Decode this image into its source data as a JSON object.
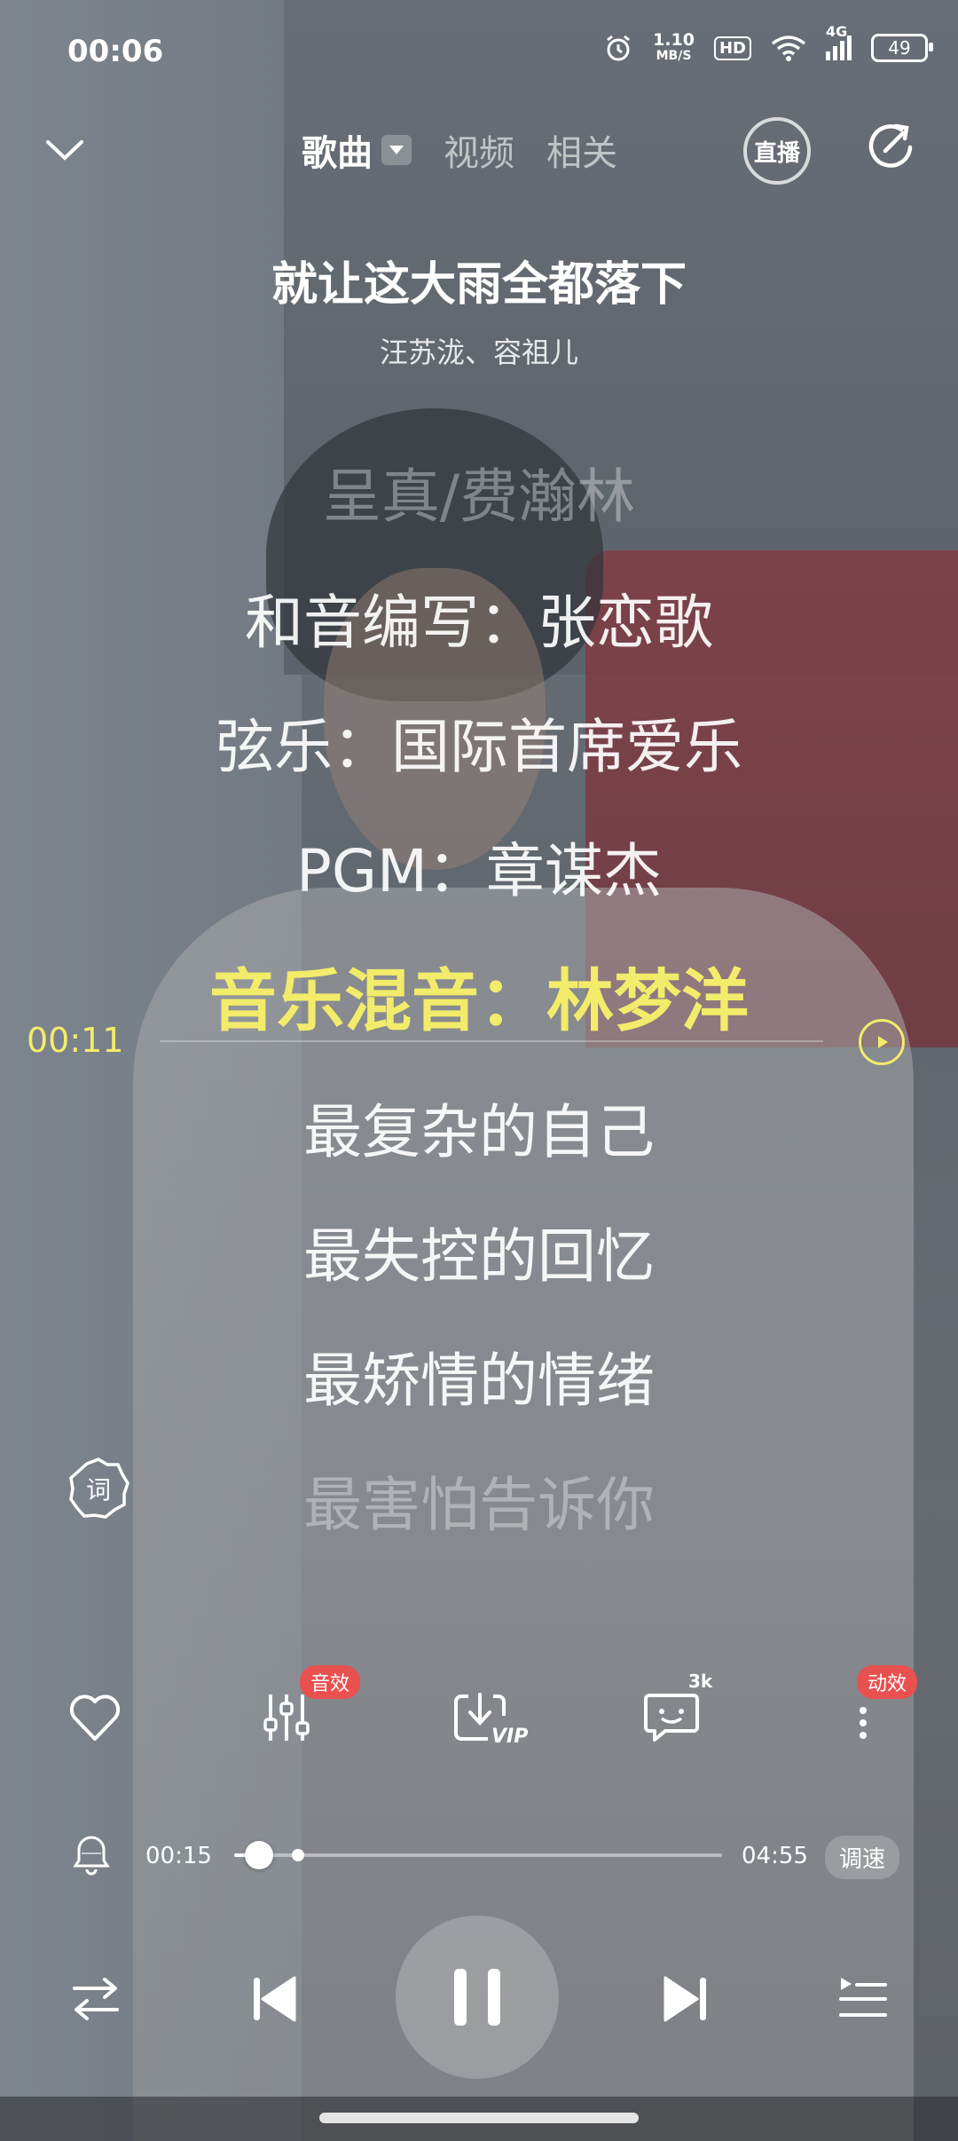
{
  "status_bar": {
    "time": "00:06",
    "net_speed_value": "1.10",
    "net_speed_unit": "MB/S",
    "hd_label": "HD",
    "signal_label": "4G",
    "battery": "49"
  },
  "nav": {
    "tabs": [
      {
        "label": "歌曲",
        "active": true
      },
      {
        "label": "视频",
        "active": false
      },
      {
        "label": "相关",
        "active": false
      }
    ],
    "live_label": "直播"
  },
  "song": {
    "title": "就让这大雨全都落下",
    "artist": "汪苏泷、容祖儿"
  },
  "lyrics": {
    "lines": [
      "呈真/费瀚林",
      "和音编写：张恋歌",
      "弦乐：国际首席爱乐",
      "PGM：章谋杰",
      "音乐混音：林梦洋",
      "最复杂的自己",
      "最失控的回忆",
      "最矫情的情绪",
      "最害怕告诉你"
    ],
    "active_index": 4,
    "scrub_time": "00:11",
    "lyric_badge": "词"
  },
  "actions": {
    "sound_effect_badge": "音效",
    "download_vip_label": "VIP",
    "comment_count": "3k",
    "animation_badge": "动效"
  },
  "progress": {
    "current": "00:15",
    "total": "04:55",
    "played_fraction": 0.05,
    "buffered_fraction": 0.13,
    "speed_label": "调速"
  },
  "colors": {
    "accent_yellow": "#f3ec6a",
    "badge_red": "#e8514f"
  }
}
